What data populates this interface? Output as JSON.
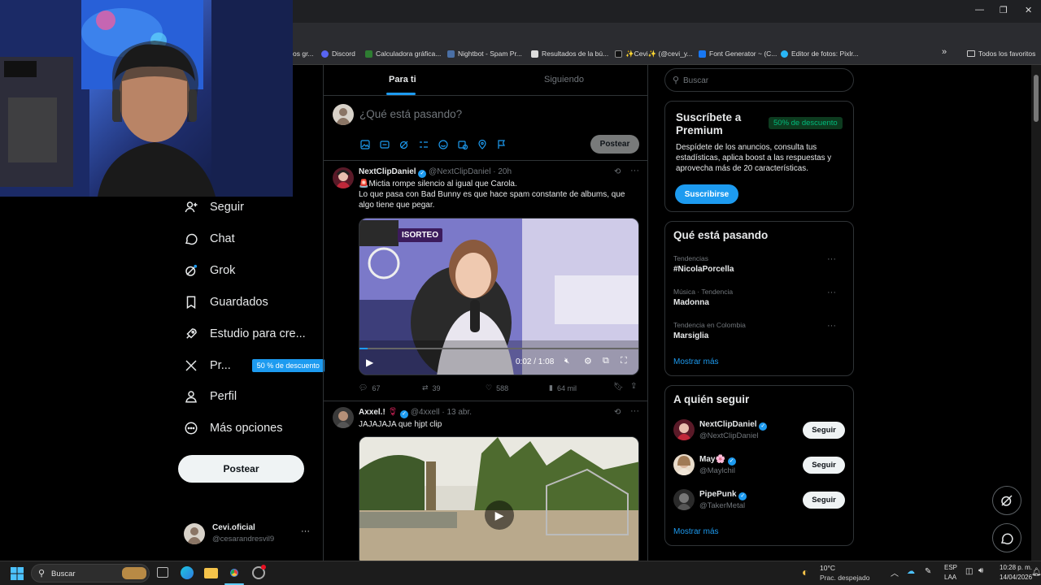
{
  "browser": {
    "bookmarks": [
      {
        "label": "os gr...",
        "color": "#8a8a8a"
      },
      {
        "label": "Discord",
        "color": "#5865f2"
      },
      {
        "label": "Calculadora gráfica...",
        "color": "#2e7d32"
      },
      {
        "label": "Nightbot - Spam Pr...",
        "color": "#4a6fa5"
      },
      {
        "label": "Resultados de la bú...",
        "color": "#dddddd"
      },
      {
        "label": "✨Cevi✨ (@cevi_y...",
        "color": "#111111"
      },
      {
        "label": "Font Generator ~ (C...",
        "color": "#1877f2"
      },
      {
        "label": "Editor de fotos: Pixlr...",
        "color": "#29b6f6"
      }
    ],
    "all_bookmarks": "Todos los favoritos",
    "more": "»"
  },
  "nav": {
    "items": [
      {
        "label": "Seguir",
        "icon": "person-plus-icon"
      },
      {
        "label": "Chat",
        "icon": "chat-bubble-icon"
      },
      {
        "label": "Grok",
        "icon": "grok-icon"
      },
      {
        "label": "Guardados",
        "icon": "bookmark-icon"
      },
      {
        "label": "Estudio para cre...",
        "icon": "rocket-icon"
      },
      {
        "label": "Pr...",
        "icon": "x-logo-icon"
      },
      {
        "label": "Perfil",
        "icon": "person-icon"
      },
      {
        "label": "Más opciones",
        "icon": "more-circle-icon"
      }
    ],
    "premium_badge": "50 % de descuento",
    "post_button": "Postear",
    "account": {
      "name": "Cevi.oficial",
      "handle": "@cesarandresvil9",
      "more": "···"
    }
  },
  "main": {
    "tabs": [
      {
        "label": "Para ti",
        "active": true
      },
      {
        "label": "Siguiendo",
        "active": false
      }
    ],
    "composer": {
      "placeholder": "¿Qué está pasando?",
      "post_button": "Postear"
    },
    "tweets": [
      {
        "name": "NextClipDaniel",
        "handle": "@NextClipDaniel",
        "time": "· 20h",
        "text_line1": "🚨Mictia rompe silencio al igual que Carola.",
        "text_line2": "Lo que pasa con Bad Bunny es que hace spam constante de albums, que algo tiene que pegar.",
        "video_badge": "ISORTEO",
        "video_time": "0:02 / 1:08",
        "replies": "67",
        "reposts": "39",
        "likes": "588",
        "views": "64 mil"
      },
      {
        "name": "Axxel.!",
        "handle": "@4xxell",
        "time": "· 13 abr.",
        "text_line1": "JAJAJAJA que hjpt clip"
      }
    ]
  },
  "right": {
    "search_placeholder": "Buscar",
    "premium": {
      "title": "Suscríbete a Premium",
      "badge": "50% de descuento",
      "body": "Despídete de los anuncios, consulta tus estadísticas, aplica boost a las respuestas y aprovecha más de 20 características.",
      "button": "Suscribirse"
    },
    "trends": {
      "title": "Qué está pasando",
      "items": [
        {
          "context": "Tendencias",
          "name": "#NicolaPorcella"
        },
        {
          "context": "Música · Tendencia",
          "name": "Madonna"
        },
        {
          "context": "Tendencia en Colombia",
          "name": "Marsiglia"
        }
      ],
      "show_more": "Mostrar más"
    },
    "who_to_follow": {
      "title": "A quién seguir",
      "items": [
        {
          "name": "NextClipDaniel",
          "handle": "@NextClipDaniel",
          "button": "Seguir"
        },
        {
          "name": "May🌸",
          "handle": "@Maylchil",
          "button": "Seguir"
        },
        {
          "name": "PipePunk",
          "handle": "@TakerMetal",
          "button": "Seguir"
        }
      ],
      "show_more": "Mostrar más"
    }
  },
  "taskbar": {
    "search": "Buscar",
    "weather_temp": "10°C",
    "weather_desc": "Prac. despejado",
    "lang_line1": "ESP",
    "lang_line2": "LAA",
    "time": "10:28 p. m.",
    "date": "14/04/2026"
  }
}
